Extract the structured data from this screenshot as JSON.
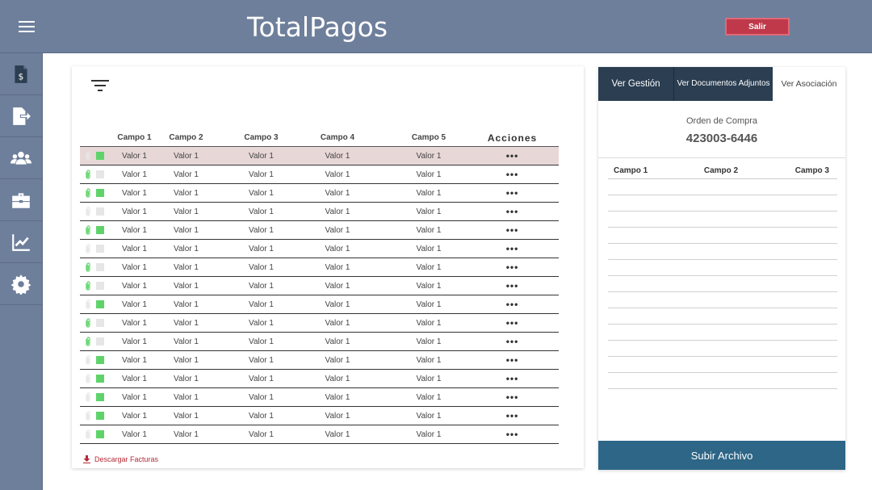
{
  "header": {
    "title": "TotalPagos",
    "logout_label": "Salir"
  },
  "sidebar": {
    "items": [
      {
        "icon": "invoice-icon"
      },
      {
        "icon": "export-file-icon"
      },
      {
        "icon": "users-icon"
      },
      {
        "icon": "briefcase-icon"
      },
      {
        "icon": "chart-icon"
      },
      {
        "icon": "settings-icon"
      }
    ]
  },
  "table": {
    "headers": [
      "Campo 1",
      "Campo 2",
      "Campo 3",
      "Campo 4",
      "Campo 5",
      "Acciones"
    ],
    "rows": [
      {
        "clip": false,
        "note": true,
        "cells": [
          "Valor 1",
          "Valor 1",
          "Valor 1",
          "Valor 1",
          "Valor 1"
        ],
        "actions": "•••"
      },
      {
        "clip": true,
        "note": false,
        "cells": [
          "Valor 1",
          "Valor 1",
          "Valor 1",
          "Valor 1",
          "Valor 1"
        ],
        "actions": "•••"
      },
      {
        "clip": true,
        "note": true,
        "cells": [
          "Valor 1",
          "Valor 1",
          "Valor 1",
          "Valor 1",
          "Valor 1"
        ],
        "actions": "•••"
      },
      {
        "clip": false,
        "note": false,
        "cells": [
          "Valor 1",
          "Valor 1",
          "Valor 1",
          "Valor 1",
          "Valor 1"
        ],
        "actions": "•••"
      },
      {
        "clip": true,
        "note": true,
        "cells": [
          "Valor 1",
          "Valor 1",
          "Valor 1",
          "Valor 1",
          "Valor 1"
        ],
        "actions": "•••"
      },
      {
        "clip": false,
        "note": false,
        "cells": [
          "Valor 1",
          "Valor 1",
          "Valor 1",
          "Valor 1",
          "Valor 1"
        ],
        "actions": "•••"
      },
      {
        "clip": true,
        "note": false,
        "cells": [
          "Valor 1",
          "Valor 1",
          "Valor 1",
          "Valor 1",
          "Valor 1"
        ],
        "actions": "•••"
      },
      {
        "clip": true,
        "note": false,
        "cells": [
          "Valor 1",
          "Valor 1",
          "Valor 1",
          "Valor 1",
          "Valor 1"
        ],
        "actions": "•••"
      },
      {
        "clip": false,
        "note": true,
        "cells": [
          "Valor 1",
          "Valor 1",
          "Valor 1",
          "Valor 1",
          "Valor 1"
        ],
        "actions": "•••"
      },
      {
        "clip": true,
        "note": false,
        "cells": [
          "Valor 1",
          "Valor 1",
          "Valor 1",
          "Valor 1",
          "Valor 1"
        ],
        "actions": "•••"
      },
      {
        "clip": true,
        "note": false,
        "cells": [
          "Valor 1",
          "Valor 1",
          "Valor 1",
          "Valor 1",
          "Valor 1"
        ],
        "actions": "•••"
      },
      {
        "clip": false,
        "note": true,
        "cells": [
          "Valor 1",
          "Valor 1",
          "Valor 1",
          "Valor 1",
          "Valor 1"
        ],
        "actions": "•••"
      },
      {
        "clip": false,
        "note": true,
        "cells": [
          "Valor 1",
          "Valor 1",
          "Valor 1",
          "Valor 1",
          "Valor 1"
        ],
        "actions": "•••"
      },
      {
        "clip": false,
        "note": true,
        "cells": [
          "Valor 1",
          "Valor 1",
          "Valor 1",
          "Valor 1",
          "Valor 1"
        ],
        "actions": "•••"
      },
      {
        "clip": false,
        "note": true,
        "cells": [
          "Valor 1",
          "Valor 1",
          "Valor 1",
          "Valor 1",
          "Valor 1"
        ],
        "actions": "•••"
      },
      {
        "clip": false,
        "note": true,
        "cells": [
          "Valor 1",
          "Valor 1",
          "Valor 1",
          "Valor 1",
          "Valor 1"
        ],
        "actions": "•••"
      }
    ],
    "download_label": "Descargar Facturas"
  },
  "right_panel": {
    "tabs": [
      "Ver Gestión",
      "Ver Documentos Adjuntos",
      "Ver Asociación"
    ],
    "order_label": "Orden de Compra",
    "order_number": "423003-6446",
    "headers": [
      "Campo 1",
      "Campo 2",
      "Campo 3"
    ],
    "upload_label": "Subir Archivo"
  },
  "colors": {
    "header_bg": "#6e7f9c",
    "logout": "#c0394a",
    "tab_dark": "#2b3e52",
    "upload": "#2d6686",
    "highlight_row": "#e8d7d7",
    "note_green": "#5fd36a",
    "download_red": "#b52a35"
  }
}
